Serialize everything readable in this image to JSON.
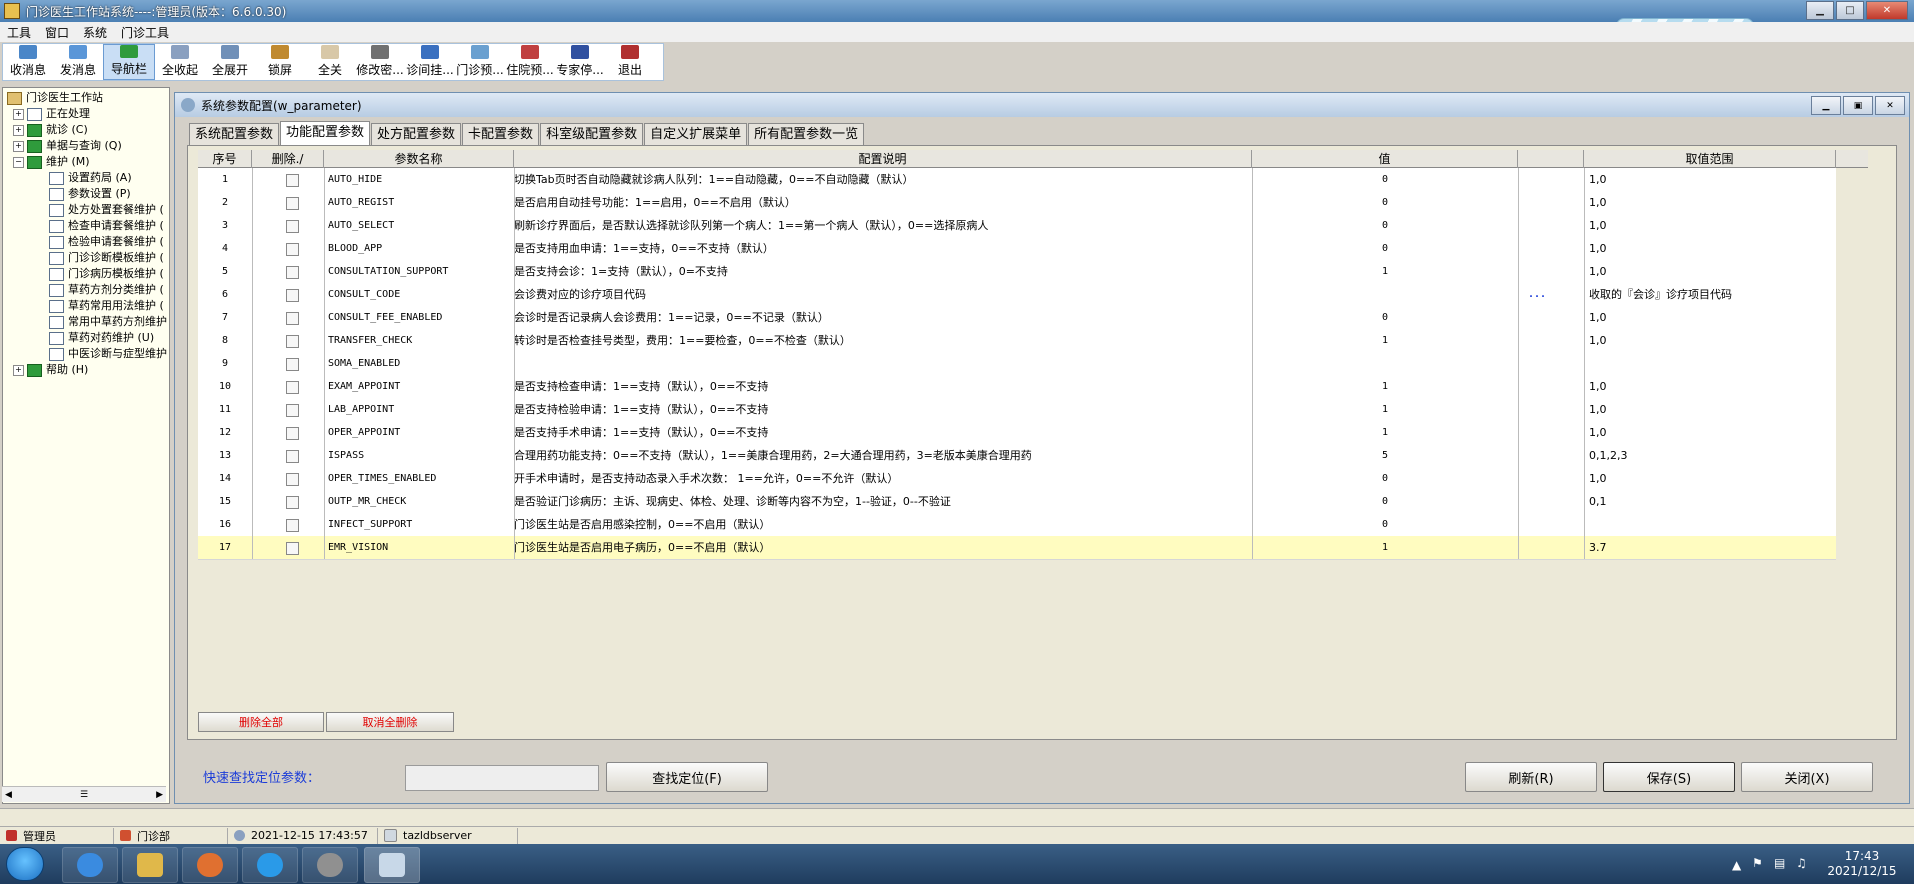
{
  "window": {
    "title": "门诊医生工作站系统----:管理员(版本：6.6.0.30)"
  },
  "menu": [
    "工具",
    "窗口",
    "系统",
    "门诊工具"
  ],
  "toolbar": [
    "收消息",
    "发消息",
    "导航栏",
    "全收起",
    "全展开",
    "锁屏",
    "全关",
    "修改密...",
    "诊间挂...",
    "门诊预...",
    "住院预...",
    "专家停...",
    "退出"
  ],
  "tree": {
    "root": "门诊医生工作站",
    "n1": "正在处理",
    "n2": "就诊 (C)",
    "n3": "单据与查询 (Q)",
    "n4": "维护 (M)",
    "c1": "设置药局 (A)",
    "c2": "参数设置 (P)",
    "c3": "处方处置套餐维护 (",
    "c4": "检查申请套餐维护 (",
    "c5": "检验申请套餐维护 (",
    "c6": "门诊诊断模板维护 (",
    "c7": "门诊病历模板维护 (",
    "c8": "草药方剂分类维护 (",
    "c9": "草药常用用法维护 (",
    "c10": "常用中草药方剂维护",
    "c11": "草药对药维护 (U)",
    "c12": "中医诊断与症型维护",
    "n5": "帮助 (H)"
  },
  "inner": {
    "title": "系统参数配置(w_parameter)",
    "tabs": [
      "系统配置参数",
      "功能配置参数",
      "处方配置参数",
      "卡配置参数",
      "科室级配置参数",
      "自定义扩展菜单",
      "所有配置参数一览"
    ],
    "active_tab": 1,
    "headers": {
      "seq": "序号",
      "del": "删除./",
      "name": "参数名称",
      "desc": "配置说明",
      "value": "值",
      "range": "取值范围"
    },
    "rows": [
      {
        "seq": "1",
        "name": "AUTO_HIDE",
        "desc": "切换Tab页时否自动隐藏就诊病人队列：1==自动隐藏，0==不自动隐藏（默认）",
        "value": "0",
        "range": "1,0",
        "dots": ""
      },
      {
        "seq": "2",
        "name": "AUTO_REGIST",
        "desc": "是否启用自动挂号功能：1==启用，0==不启用（默认）",
        "value": "0",
        "range": "1,0",
        "dots": ""
      },
      {
        "seq": "3",
        "name": "AUTO_SELECT",
        "desc": "刷新诊疗界面后，是否默认选择就诊队列第一个病人：1==第一个病人（默认），0==选择原病人",
        "value": "0",
        "range": "1,0",
        "dots": ""
      },
      {
        "seq": "4",
        "name": "BLOOD_APP",
        "desc": "是否支持用血申请：1==支持，0==不支持（默认）",
        "value": "0",
        "range": "1,0",
        "dots": ""
      },
      {
        "seq": "5",
        "name": "CONSULTATION_SUPPORT",
        "desc": "是否支持会诊：1=支持（默认），0=不支持",
        "value": "1",
        "range": "1,0",
        "dots": ""
      },
      {
        "seq": "6",
        "name": "CONSULT_CODE",
        "desc": "会诊费对应的诊疗项目代码",
        "value": "",
        "range": "收取的『会诊』诊疗项目代码",
        "dots": "..."
      },
      {
        "seq": "7",
        "name": "CONSULT_FEE_ENABLED",
        "desc": "会诊时是否记录病人会诊费用：1==记录，0==不记录（默认）",
        "value": "0",
        "range": "1,0",
        "dots": ""
      },
      {
        "seq": "8",
        "name": "TRANSFER_CHECK",
        "desc": "转诊时是否检查挂号类型，费用：1==要检查，0==不检查（默认）",
        "value": "1",
        "range": "1,0",
        "dots": ""
      },
      {
        "seq": "9",
        "name": "SOMA_ENABLED",
        "desc": "",
        "value": "",
        "range": "",
        "dots": ""
      },
      {
        "seq": "10",
        "name": "EXAM_APPOINT",
        "desc": "是否支持检查申请：1==支持（默认），0==不支持",
        "value": "1",
        "range": "1,0",
        "dots": ""
      },
      {
        "seq": "11",
        "name": "LAB_APPOINT",
        "desc": "是否支持检验申请：1==支持（默认），0==不支持",
        "value": "1",
        "range": "1,0",
        "dots": ""
      },
      {
        "seq": "12",
        "name": "OPER_APPOINT",
        "desc": "是否支持手术申请：1==支持（默认），0==不支持",
        "value": "1",
        "range": "1,0",
        "dots": ""
      },
      {
        "seq": "13",
        "name": "ISPASS",
        "desc": "合理用药功能支持：0==不支持（默认），1==美康合理用药，2=大通合理用药，3=老版本美康合理用药",
        "value": "5",
        "range": "0,1,2,3",
        "dots": ""
      },
      {
        "seq": "14",
        "name": "OPER_TIMES_ENABLED",
        "desc": "开手术申请时，是否支持动态录入手术次数： 1==允许，0==不允许（默认）",
        "value": "0",
        "range": "1,0",
        "dots": ""
      },
      {
        "seq": "15",
        "name": "OUTP_MR_CHECK",
        "desc": "是否验证门诊病历：主诉、现病史、体检、处理、诊断等内容不为空，1--验证，0--不验证",
        "value": "0",
        "range": "0,1",
        "dots": ""
      },
      {
        "seq": "16",
        "name": "INFECT_SUPPORT",
        "desc": "门诊医生站是否启用感染控制，0==不启用（默认）",
        "value": "0",
        "range": "",
        "dots": ""
      },
      {
        "seq": "17",
        "name": "EMR_VISION",
        "desc": "门诊医生站是否启用电子病历，0==不启用（默认）",
        "value": "1",
        "range": "3.7",
        "dots": ""
      }
    ],
    "selected_row": 17,
    "grid_buttons": {
      "delete_all": "删除全部",
      "cancel_delete": "取消全删除"
    },
    "quick_label": "快速查找定位参数：",
    "quick_value": "",
    "buttons": {
      "find": "查找定位(F)",
      "refresh": "刷新(R)",
      "save": "保存(S)",
      "close": "关闭(X)"
    }
  },
  "status": {
    "user": "管理员",
    "dept": "门诊部",
    "datetime": "2021-12-15  17:43:57",
    "server": "tazldbserver"
  },
  "clock": {
    "time": "17:43",
    "date": "2021/12/15"
  }
}
